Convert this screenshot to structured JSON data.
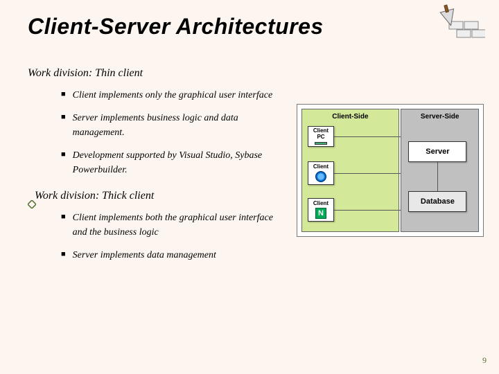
{
  "title": "Client-Server Architectures",
  "section1": {
    "heading": "Work division: Thin client",
    "bullets": [
      "Client implements only the graphical user interface",
      "Server implements business logic and data management.",
      "Development supported by Visual Studio, Sybase Powerbuilder."
    ]
  },
  "section2": {
    "heading": "Work division: Thick client",
    "bullets": [
      "Client implements both the graphical user interface and the business logic",
      "Server implements data management"
    ]
  },
  "diagram": {
    "clientLabel": "Client-Side",
    "serverLabel": "Server-Side",
    "clientPcLabel": "Client PC",
    "ieLabel": "Client",
    "nLabel": "Client",
    "nLetter": "N",
    "serverBox": "Server",
    "dbBox": "Database"
  },
  "pageNumber": "9"
}
